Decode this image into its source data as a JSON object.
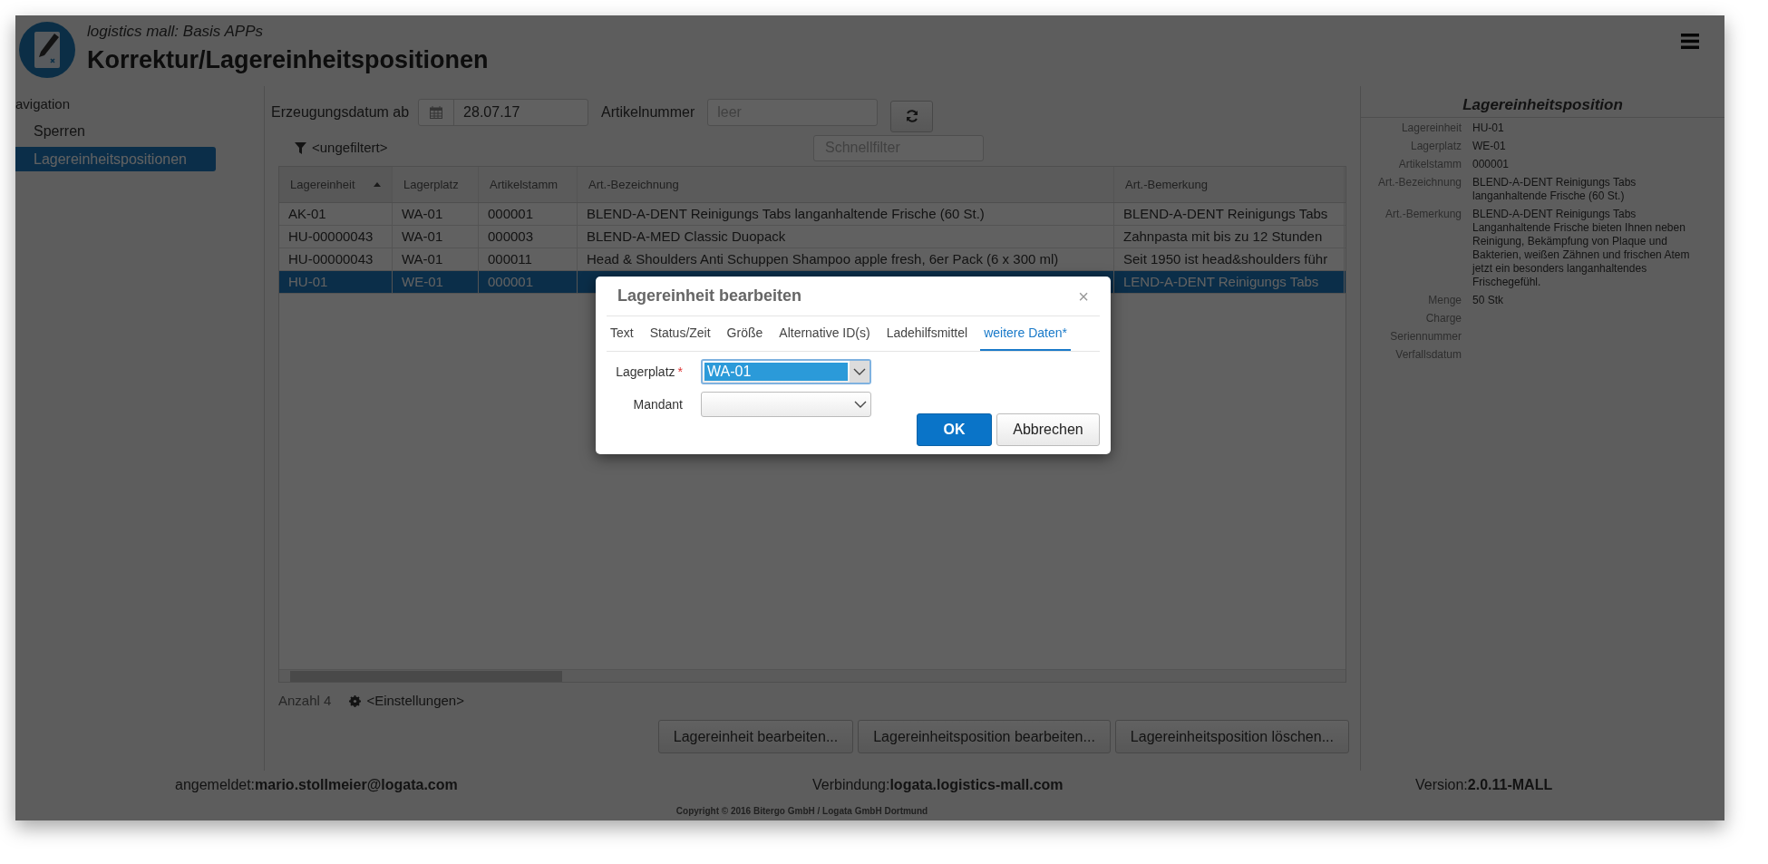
{
  "header": {
    "subtitle": "logistics mall: Basis APPs",
    "title": "Korrektur/Lagereinheitspositionen"
  },
  "sidebar": {
    "heading": "avigation",
    "items": [
      {
        "label": "Sperren",
        "selected": false
      },
      {
        "label": "Lagereinheitspositionen",
        "selected": true
      }
    ]
  },
  "filters": {
    "date_label": "Erzeugungsdatum ab",
    "date_value": "28.07.17",
    "article_label": "Artikelnummer",
    "article_placeholder": "leer",
    "filter_status": "<ungefiltert>",
    "quick_filter_placeholder": "Schnellfilter"
  },
  "table": {
    "columns": [
      {
        "label": "Lagereinheit",
        "sorted": true
      },
      {
        "label": "Lagerplatz",
        "sorted": false
      },
      {
        "label": "Artikelstamm",
        "sorted": false
      },
      {
        "label": "Art.-Bezeichnung",
        "sorted": false
      },
      {
        "label": "Art.-Bemerkung",
        "sorted": false
      }
    ],
    "rows": [
      {
        "selected": false,
        "cells": [
          "AK-01",
          "WA-01",
          "000001",
          "BLEND-A-DENT Reinigungs Tabs langanhaltende Frische (60 St.)",
          "BLEND-A-DENT Reinigungs Tabs"
        ]
      },
      {
        "selected": false,
        "cells": [
          "HU-00000043",
          "WA-01",
          "000003",
          "BLEND-A-MED Classic Duopack",
          "Zahnpasta mit bis zu 12 Stunden"
        ]
      },
      {
        "selected": false,
        "cells": [
          "HU-00000043",
          "WA-01",
          "000011",
          "Head & Shoulders Anti Schuppen Shampoo apple fresh, 6er Pack (6 x 300 ml)",
          "Seit 1950 ist head&shoulders führ"
        ]
      },
      {
        "selected": true,
        "cells": [
          "HU-01",
          "WE-01",
          "000001",
          null,
          "LEND-A-DENT Reinigungs Tabs"
        ]
      }
    ]
  },
  "count": "Anzahl 4",
  "settings": "<Einstellungen>",
  "actions": [
    "Lagereinheit bearbeiten...",
    "Lagereinheitsposition bearbeiten...",
    "Lagereinheitsposition löschen..."
  ],
  "detail": {
    "title": "Lagereinheitsposition",
    "fields": [
      {
        "label": "Lagereinheit",
        "value": "HU-01"
      },
      {
        "label": "Lagerplatz",
        "value": "WE-01"
      },
      {
        "label": "Artikelstamm",
        "value": "000001"
      },
      {
        "label": "Art.-Bezeichnung",
        "value": "BLEND-A-DENT Reinigungs Tabs langanhaltende Frische (60 St.)"
      },
      {
        "label": "Art.-Bemerkung",
        "value": "BLEND-A-DENT Reinigungs Tabs Langanhaltende Frische bieten Ihnen neben Reinigung, Bekämpfung von Plaque und Bakterien, weißen Zähnen und frischen Atem jetzt ein besonders langanhaltendes Frischegefühl."
      },
      {
        "label": "Menge",
        "value": "50 Stk"
      },
      {
        "label": "Charge"
      },
      {
        "label": "Seriennummer"
      },
      {
        "label": "Verfallsdatum"
      }
    ]
  },
  "status_bar": {
    "user": "angemeldet:**mario.stollmeier@logata.com**",
    "connection": "Verbindung:**logata.logistics-mall.com**",
    "version": "Version:**2.0.11-MALL**",
    "copyright": "Copyright © 2016 Bitergo GmbH / Logata GmbH Dortmund"
  },
  "dialog": {
    "title": "Lagereinheit bearbeiten",
    "close": "×",
    "tabs": [
      {
        "label": "Text",
        "selected": false
      },
      {
        "label": "Status/Zeit",
        "selected": false
      },
      {
        "label": "Größe",
        "selected": false
      },
      {
        "label": "Alternative ID(s)",
        "selected": false
      },
      {
        "label": "Ladehilfsmittel",
        "selected": false
      },
      {
        "label": "weitere Daten*",
        "selected": true
      }
    ],
    "fields": [
      {
        "label": "Lagerplatz",
        "required_mark": "*",
        "value": "WA-01",
        "focused": true
      },
      {
        "label": "Mandant",
        "focused": false
      }
    ],
    "ok": "OK",
    "cancel": "Abbrechen"
  }
}
